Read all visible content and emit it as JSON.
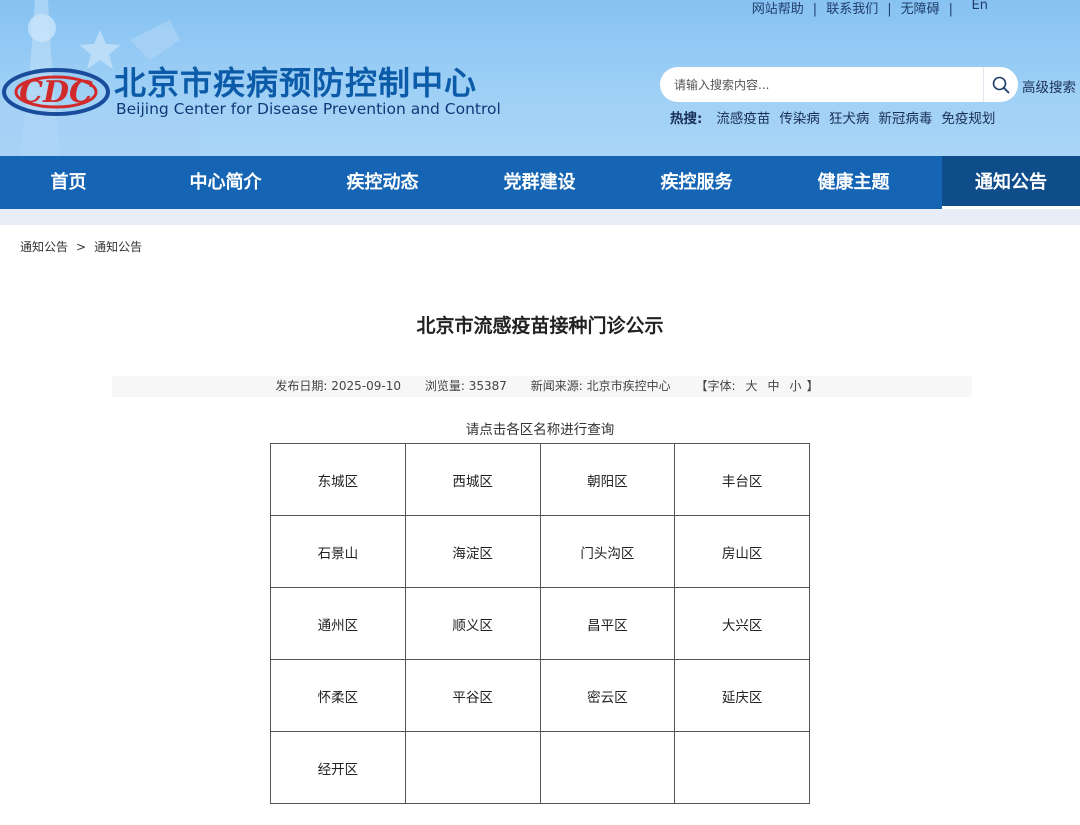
{
  "header": {
    "top_links": [
      "网站帮助",
      "联系我们",
      "无障碍"
    ],
    "lang": "En",
    "title_cn": "北京市疾病预防控制中心",
    "title_en": "Beijing Center for Disease Prevention and Control",
    "logo_text": "CDC",
    "search": {
      "placeholder": "请输入搜索内容...",
      "advanced_label": "高级搜索"
    },
    "hot": {
      "label": "热搜:",
      "items": [
        "流感疫苗",
        "传染病",
        "狂犬病",
        "新冠病毒",
        "免疫规划"
      ]
    },
    "colors": {
      "header_bg": "#9fd0f6",
      "title": "#0c5ba8",
      "nav_bg": "#1565b4",
      "nav_active": "#0f4c8a"
    }
  },
  "nav": {
    "items": [
      "首页",
      "中心简介",
      "疾控动态",
      "党群建设",
      "疾控服务",
      "健康主题",
      "通知公告"
    ],
    "active_index": 6
  },
  "breadcrumb": {
    "items": [
      "通知公告",
      "通知公告"
    ],
    "separator": ">"
  },
  "article": {
    "title": "北京市流感疫苗接种门诊公示",
    "meta": {
      "date_label": "发布日期:",
      "date": "2025-09-10",
      "views_label": "浏览量:",
      "views": "35387",
      "source_label": "新闻来源:",
      "source": "北京市疾控中心",
      "font_label": "【字体:",
      "font_sizes": [
        "大",
        "中",
        "小"
      ],
      "font_close": "】"
    },
    "hint": "请点击各区名称进行查询",
    "districts": [
      [
        "东城区",
        "西城区",
        "朝阳区",
        "丰台区"
      ],
      [
        "石景山",
        "海淀区",
        "门头沟区",
        "房山区"
      ],
      [
        "通州区",
        "顺义区",
        "昌平区",
        "大兴区"
      ],
      [
        "怀柔区",
        "平谷区",
        "密云区",
        "延庆区"
      ],
      [
        "经开区",
        "",
        "",
        ""
      ]
    ]
  }
}
